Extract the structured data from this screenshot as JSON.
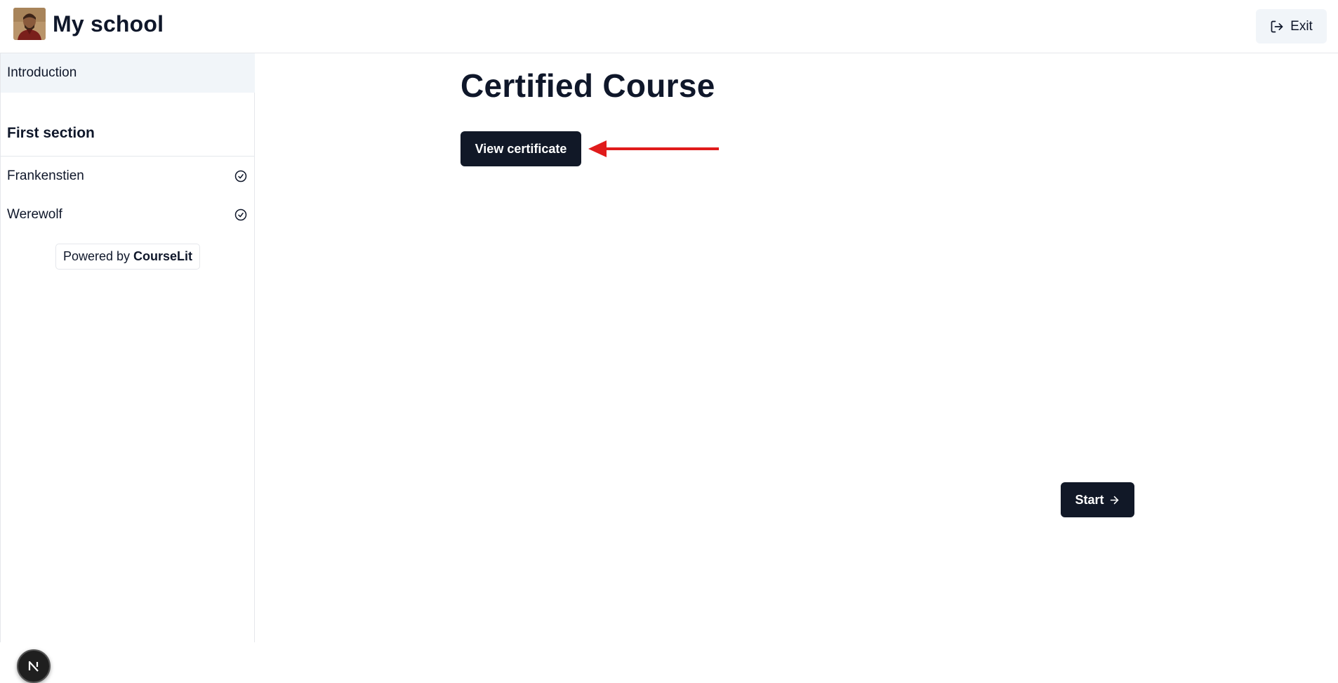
{
  "header": {
    "school_name": "My school",
    "exit_label": "Exit",
    "exit_icon": "log-out-icon"
  },
  "sidebar": {
    "intro_label": "Introduction",
    "section_title": "First section",
    "lessons": [
      {
        "label": "Frankenstien",
        "icon": "check-circle-icon"
      },
      {
        "label": "Werewolf",
        "icon": "check-circle-icon"
      }
    ],
    "powered_prefix": "Powered by",
    "powered_brand": "CourseLit",
    "next_badge_letter": "N"
  },
  "main": {
    "course_title": "Certified Course",
    "view_certificate_label": "View certificate",
    "start_label": "Start",
    "start_icon": "arrow-right-icon"
  },
  "colors": {
    "primary_button": "#111827",
    "sidebar_active_bg": "#f1f5f9",
    "annotation_arrow": "#e01b1b",
    "text": "#0f172a",
    "border": "#e5e7eb"
  }
}
